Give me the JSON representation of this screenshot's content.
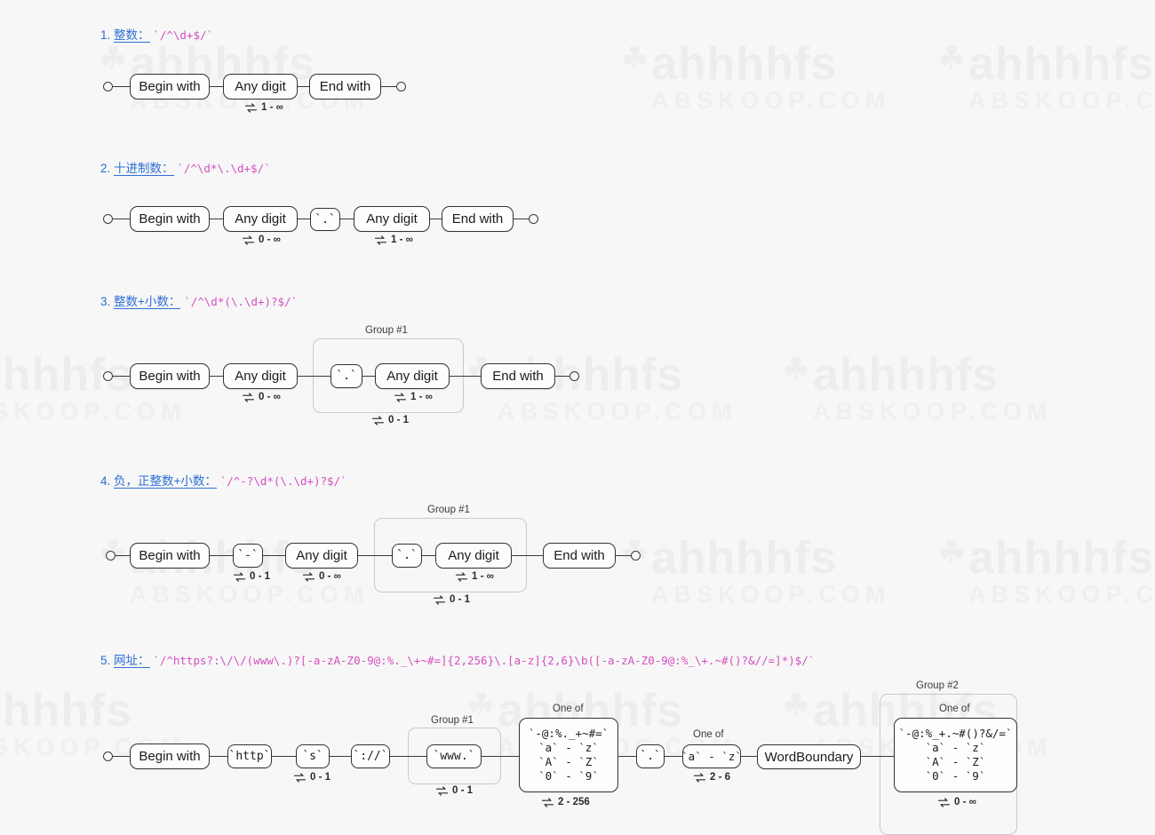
{
  "watermark": {
    "main": "ahhhhfs",
    "sub": "ABSKOOP.COM",
    "logo": "☘"
  },
  "sections": [
    {
      "id": "s1",
      "num": "1.",
      "name": "整数：",
      "regex": "`/^\\d+$/`",
      "nodes": {
        "begin": "Begin with",
        "digit": "Any digit",
        "end": "End with"
      },
      "repeats": {
        "digit": "1 - ∞"
      }
    },
    {
      "id": "s2",
      "num": "2.",
      "name": "十进制数：",
      "regex": "`/^\\d*\\.\\d+$/`",
      "nodes": {
        "begin": "Begin with",
        "digit1": "Any digit",
        "dot": "`.`",
        "digit2": "Any digit",
        "end": "End with"
      },
      "repeats": {
        "digit1": "0 - ∞",
        "digit2": "1 - ∞"
      }
    },
    {
      "id": "s3",
      "num": "3.",
      "name": "整数+小数：",
      "regex": "`/^\\d*(\\.\\d+)?$/`",
      "nodes": {
        "begin": "Begin with",
        "digit1": "Any digit",
        "dot": "`.`",
        "digit2": "Any digit",
        "end": "End with"
      },
      "group_label": "Group #1",
      "repeats": {
        "digit1": "0 - ∞",
        "digit2": "1 - ∞",
        "group": "0 - 1"
      }
    },
    {
      "id": "s4",
      "num": "4.",
      "name": "负，正整数+小数：",
      "regex": "`/^-?\\d*(\\.\\d+)?$/`",
      "nodes": {
        "begin": "Begin with",
        "minus": "`-`",
        "digit1": "Any digit",
        "dot": "`.`",
        "digit2": "Any digit",
        "end": "End with"
      },
      "group_label": "Group #1",
      "repeats": {
        "minus": "0 - 1",
        "digit1": "0 - ∞",
        "digit2": "1 - ∞",
        "group": "0 - 1"
      }
    },
    {
      "id": "s5",
      "num": "5.",
      "name": "网址：",
      "regex": "`/^https?:\\/\\/(www\\.)?[-a-zA-Z0-9@:%._\\+~#=]{2,256}\\.[a-z]{2,6}\\b([-a-zA-Z0-9@:%_\\+.~#()?&//=]*)$/`",
      "nodes": {
        "begin": "Begin with",
        "http": "`http`",
        "s": "`s`",
        "slashes": "`://`",
        "www": "`www.`",
        "dot": "`.`",
        "wordboundary": "WordBoundary"
      },
      "oneof_label": "One of",
      "group1_label": "Group #1",
      "group2_label": "Group #2",
      "oneof_domain": [
        "`-@:%._+~#=`",
        "`a` - `z`",
        "`A` - `Z`",
        "`0` - `9`"
      ],
      "oneof_tld": [
        "`a` - `z`"
      ],
      "oneof_path": [
        "`-@:%_+.~#()?&/=`",
        "`a` - `z`",
        "`A` - `Z`",
        "`0` - `9`"
      ],
      "repeats": {
        "s": "0 - 1",
        "group1": "0 - 1",
        "oneof_domain": "2 - 256",
        "oneof_tld": "2 - 6",
        "group2": "0 - ∞"
      }
    }
  ]
}
